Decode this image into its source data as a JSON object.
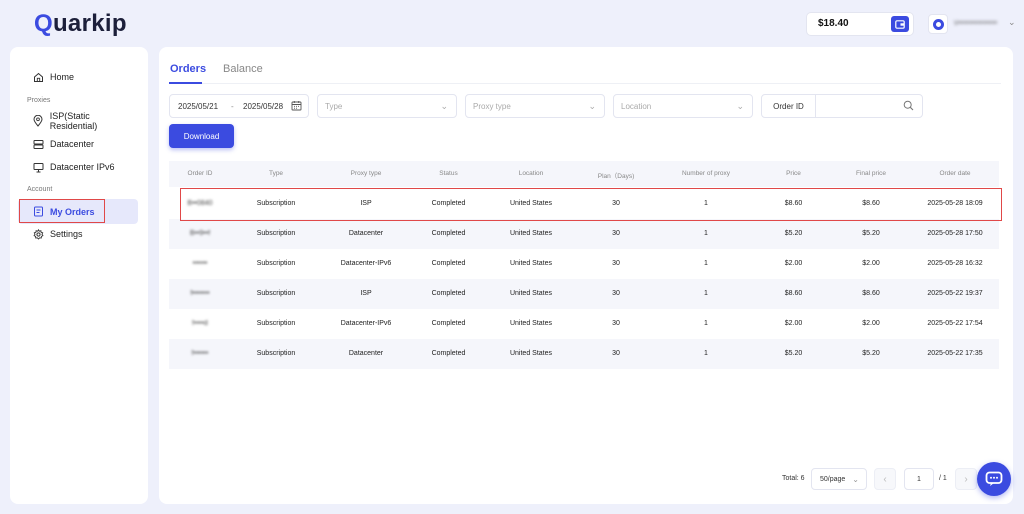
{
  "brand": {
    "logo_text": "uarkip",
    "logo_q": "Q",
    "accent_color": "#3b4be0"
  },
  "header": {
    "balance": "$18.40",
    "wallet_icon": "wallet-icon",
    "username": "v••••••••••••••"
  },
  "sidebar": {
    "items": [
      {
        "label": "Home",
        "icon": "home-icon"
      },
      {
        "label": "ISP(Static Residential)",
        "icon": "location-pin-icon"
      },
      {
        "label": "Datacenter",
        "icon": "server-icon"
      },
      {
        "label": "Datacenter IPv6",
        "icon": "monitor-icon"
      },
      {
        "label": "My Orders",
        "icon": "orders-icon",
        "active": true
      },
      {
        "label": "Settings",
        "icon": "gear-icon"
      }
    ],
    "sections": {
      "proxies": "Proxies",
      "account": "Account"
    }
  },
  "tabs": [
    {
      "label": "Orders",
      "active": true
    },
    {
      "label": "Balance",
      "active": false
    }
  ],
  "filters": {
    "date_start": "2025/05/21",
    "date_sep": "-",
    "date_end": "2025/05/28",
    "type_placeholder": "Type",
    "proxy_type_placeholder": "Proxy type",
    "location_placeholder": "Location",
    "order_id_label": "Order ID"
  },
  "download_label": "Download",
  "table": {
    "columns": [
      "Order ID",
      "Type",
      "Proxy type",
      "Status",
      "Location",
      "Plan（Days)",
      "Number of proxy",
      "Price",
      "Final price",
      "Order date"
    ],
    "rows": [
      [
        "B••0840",
        "Subscription",
        "ISP",
        "Completed",
        "United States",
        "30",
        "1",
        "$8.60",
        "$8.60",
        "2025-05-28 18:09"
      ],
      [
        "B••9••f",
        "Subscription",
        "Datacenter",
        "Completed",
        "United States",
        "30",
        "1",
        "$5.20",
        "$5.20",
        "2025-05-28 17:50"
      ],
      [
        "••••••",
        "Subscription",
        "Datacenter-IPv6",
        "Completed",
        "United States",
        "30",
        "1",
        "$2.00",
        "$2.00",
        "2025-05-28 16:32"
      ],
      [
        "f•••••••",
        "Subscription",
        "ISP",
        "Completed",
        "United States",
        "30",
        "1",
        "$8.60",
        "$8.60",
        "2025-05-22 19:37"
      ],
      [
        "f••••d",
        "Subscription",
        "Datacenter-IPv6",
        "Completed",
        "United States",
        "30",
        "1",
        "$2.00",
        "$2.00",
        "2025-05-22 17:54"
      ],
      [
        "f••••••",
        "Subscription",
        "Datacenter",
        "Completed",
        "United States",
        "30",
        "1",
        "$5.20",
        "$5.20",
        "2025-05-22 17:35"
      ]
    ]
  },
  "pagination": {
    "total": "Total: 6",
    "page_size": "50/page",
    "current_page": "1",
    "of_pages": "/ 1"
  }
}
